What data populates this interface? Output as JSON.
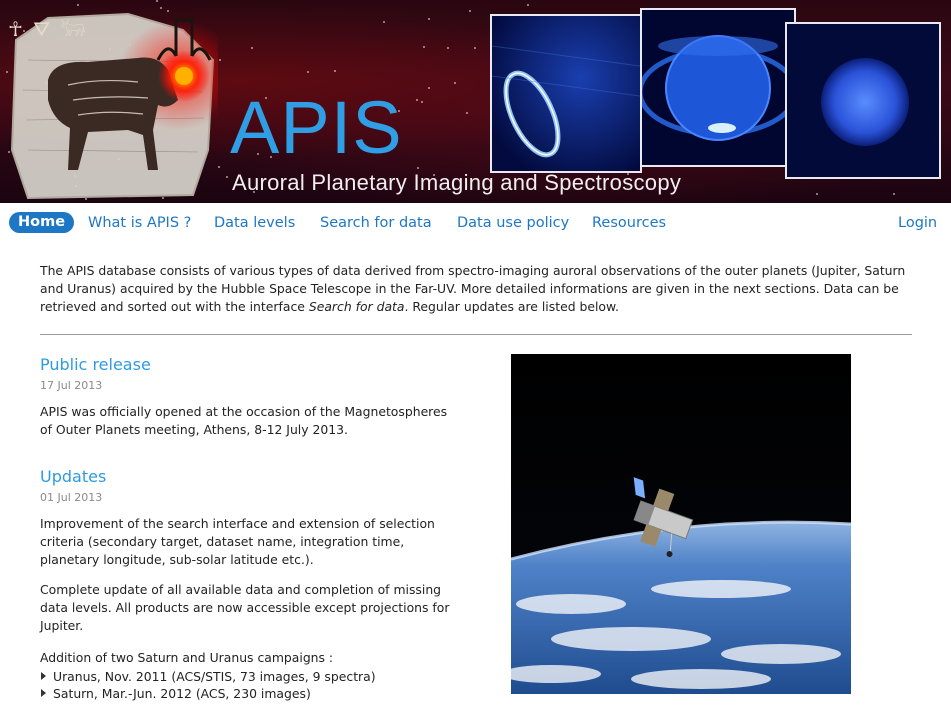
{
  "banner": {
    "title": "APIS",
    "subtitle": "Auroral Planetary Imaging and Spectroscopy"
  },
  "nav": {
    "items": [
      {
        "label": "Home"
      },
      {
        "label": "What is APIS ?"
      },
      {
        "label": "Data levels"
      },
      {
        "label": "Search for data"
      },
      {
        "label": "Data use policy"
      },
      {
        "label": "Resources"
      }
    ],
    "login": "Login"
  },
  "intro": {
    "text_before": "The APIS database consists of various types of data derived from spectro-imaging auroral observations of the outer planets (Jupiter, Saturn and Uranus) acquired by the Hubble Space Telescope in the Far-UV. More detailed informations are given in the next sections. Data can be retrieved and sorted out with the interface ",
    "emphasis": "Search for data",
    "text_after": ". Regular updates are listed below."
  },
  "news": [
    {
      "title": "Public release",
      "date": "17 Jul 2013",
      "paragraphs": [
        "APIS was officially opened at the occasion of the Magnetospheres of Outer Planets meeting, Athens, 8-12 July 2013."
      ]
    },
    {
      "title": "Updates",
      "date": "01 Jul 2013",
      "paragraphs": [
        "Improvement of the search interface and extension of selection criteria (secondary target, dataset name, integration time, planetary longitude, sub-solar latitude etc.).",
        "Complete update of all available data and completion of missing data levels. All products are now accessible except projections for Jupiter.",
        "Addition of two Saturn and Uranus campaigns :"
      ],
      "list": [
        "Uranus, Nov. 2011 (ACS/STIS, 73 images, 9 spectra)",
        "Saturn, Mar.-Jun. 2012 (ACS, 230 images)"
      ]
    }
  ],
  "colors": {
    "nav_link": "#1d77c4",
    "heading": "#2e9be0",
    "title": "#2f9ee5"
  }
}
